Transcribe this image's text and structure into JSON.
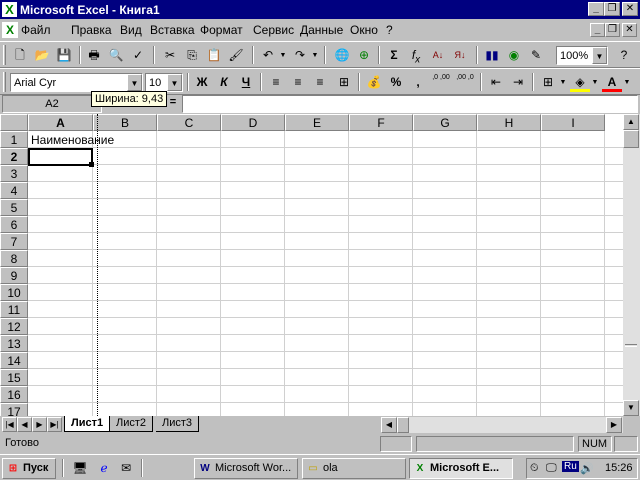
{
  "window": {
    "title": "Microsoft Excel - Книга1"
  },
  "menu": [
    "Файл",
    "Правка",
    "Вид",
    "Вставка",
    "Формат",
    "Сервис",
    "Данные",
    "Окно",
    "?"
  ],
  "standard_toolbar": {
    "zoom": "100%"
  },
  "format_toolbar": {
    "font": "Arial Cyr",
    "size": "10",
    "bold": "Ж",
    "italic": "К",
    "underline": "Ч",
    "percent": "%",
    "comma": ",",
    "inc_dec": ",0 ,00",
    "dec_dec": ",00 ,0"
  },
  "formula_bar": {
    "name_box": "A2",
    "tooltip": "Ширина: 9,43",
    "equals": "="
  },
  "sheet": {
    "columns": [
      "A",
      "B",
      "C",
      "D",
      "E",
      "F",
      "G",
      "H",
      "I"
    ],
    "rows": [
      "1",
      "2",
      "3",
      "4",
      "5",
      "6",
      "7",
      "8",
      "9",
      "10",
      "11",
      "12",
      "13",
      "14",
      "15",
      "16",
      "17"
    ],
    "cell_A1": "Наименование"
  },
  "sheet_tabs": [
    "Лист1",
    "Лист2",
    "Лист3"
  ],
  "status": {
    "ready": "Готово",
    "num": "NUM"
  },
  "taskbar": {
    "start": "Пуск",
    "tasks": [
      "Microsoft Wor...",
      "ola",
      "Microsoft E..."
    ],
    "lang": "Ru",
    "clock": "15:26"
  }
}
